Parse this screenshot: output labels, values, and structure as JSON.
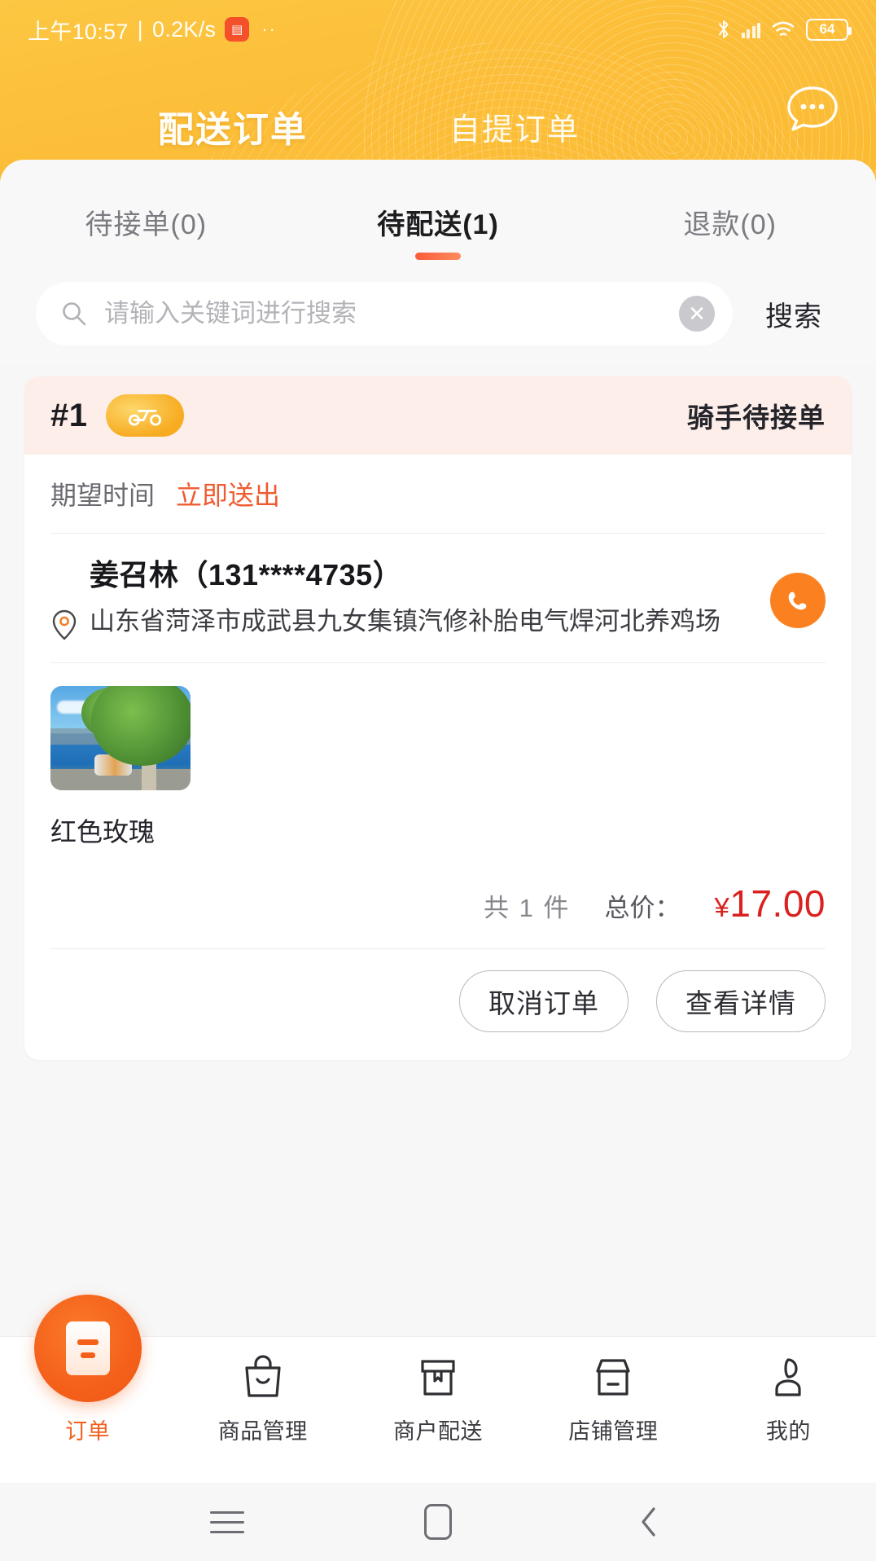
{
  "statusbar": {
    "time": "上午10:57",
    "separator": "|",
    "netspeed": "0.2K/s",
    "app_icon": "notification-app-icon",
    "more_dots": "··",
    "bluetooth_icon": "bluetooth-icon",
    "signal_icon": "signal-bars-icon",
    "wifi_icon": "wifi-icon",
    "battery_level": "64"
  },
  "header": {
    "tabs": [
      {
        "label": "配送订单",
        "active": true
      },
      {
        "label": "自提订单",
        "active": false
      }
    ],
    "chat_icon": "chat-bubble-icon",
    "brand_color": "#fcc03a"
  },
  "subtabs": [
    {
      "label": "待接单(0)",
      "active": false
    },
    {
      "label": "待配送(1)",
      "active": true
    },
    {
      "label": "退款(0)",
      "active": false
    }
  ],
  "search": {
    "placeholder": "请输入关键词进行搜索",
    "value": "",
    "search_icon": "search-icon",
    "clear_icon": "clear-circle-icon",
    "button_label": "搜索"
  },
  "order": {
    "number": "#1",
    "rider_badge_icon": "scooter-badge-icon",
    "status": "骑手待接单",
    "time_label": "期望时间",
    "time_value": "立即送出",
    "customer_name": "姜召林（131****4735）",
    "location_icon": "location-pin-icon",
    "address": "山东省菏泽市成武县九女集镇汽修补胎电气焊河北养鸡场",
    "call_icon": "phone-call-icon",
    "product": {
      "name": "红色玫瑰",
      "thumb_icon": "product-photo-thumbnail"
    },
    "total_count": "共 1 件",
    "total_label": "总价：",
    "currency": "¥",
    "total_amount": "17.00",
    "accent_price_color": "#d9221f",
    "buttons": [
      {
        "label": "取消订单"
      },
      {
        "label": "查看详情"
      }
    ]
  },
  "bottomnav": {
    "active_color": "#f4611f",
    "items": [
      {
        "label": "订单",
        "icon": "order-sheet-icon",
        "active": true
      },
      {
        "label": "商品管理",
        "icon": "shopping-bag-icon",
        "active": false
      },
      {
        "label": "商户配送",
        "icon": "parcel-box-icon",
        "active": false
      },
      {
        "label": "店铺管理",
        "icon": "storefront-icon",
        "active": false
      },
      {
        "label": "我的",
        "icon": "person-icon",
        "active": false
      }
    ]
  },
  "androidnav": {
    "recents_icon": "recents-menu-icon",
    "home_icon": "home-square-icon",
    "back_icon": "back-chevron-icon"
  }
}
